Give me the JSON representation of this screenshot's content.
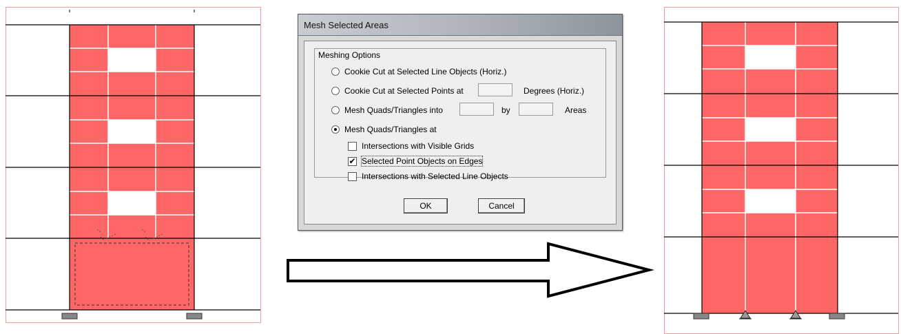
{
  "dialog": {
    "title": "Mesh Selected Areas",
    "group_label": "Meshing Options",
    "options": {
      "cookie_line": "Cookie Cut at Selected Line Objects (Horiz.)",
      "cookie_points": "Cookie Cut at Selected Points at",
      "cookie_points_unit": "Degrees (Horiz.)",
      "mesh_into": "Mesh Quads/Triangles into",
      "mesh_into_by": "by",
      "mesh_into_unit": "Areas",
      "mesh_at": "Mesh Quads/Triangles at"
    },
    "selected_option": "mesh_at",
    "checks": {
      "visible_grids": {
        "label": "Intersections with Visible Grids",
        "checked": false
      },
      "point_objects": {
        "label": "Selected Point Objects on Edges",
        "checked": true
      },
      "line_objects": {
        "label": "Intersections with Selected Line Objects",
        "checked": false
      }
    },
    "checkmark": "✔",
    "fields": {
      "degrees": "",
      "mesh_x": "",
      "mesh_y": ""
    },
    "buttons": {
      "ok": "OK",
      "cancel": "Cancel"
    }
  },
  "colors": {
    "area_fill": "#ff6666",
    "grid_line": "#000000",
    "frame_border": "#e8a0a0"
  }
}
